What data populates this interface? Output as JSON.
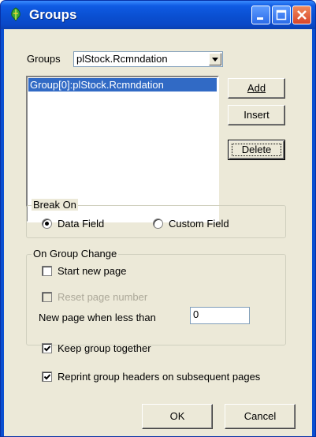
{
  "window": {
    "title": "Groups",
    "icon": "app-icon"
  },
  "groups_selector": {
    "label": "Groups",
    "selected": "plStock.Rcmndation"
  },
  "group_list": {
    "items": [
      "Group[0]:plStock.Rcmndation"
    ]
  },
  "list_buttons": {
    "add": "Add",
    "insert": "Insert",
    "delete": "Delete"
  },
  "break_on": {
    "title": "Break On",
    "data_field": "Data Field",
    "custom_field": "Custom Field",
    "selected": "Data Field"
  },
  "on_group_change": {
    "title": "On Group Change",
    "start_new_page": {
      "label": "Start new page",
      "checked": false
    },
    "reset_page_number": {
      "label": "Reset page number",
      "checked": false,
      "enabled": false
    },
    "new_page_when_less_than": {
      "label": "New page when less than",
      "value": "0"
    }
  },
  "options": {
    "keep_together": {
      "label": "Keep group together",
      "checked": true
    },
    "reprint_headers": {
      "label": "Reprint group headers on subsequent pages",
      "checked": true
    }
  },
  "footer": {
    "ok": "OK",
    "cancel": "Cancel"
  }
}
